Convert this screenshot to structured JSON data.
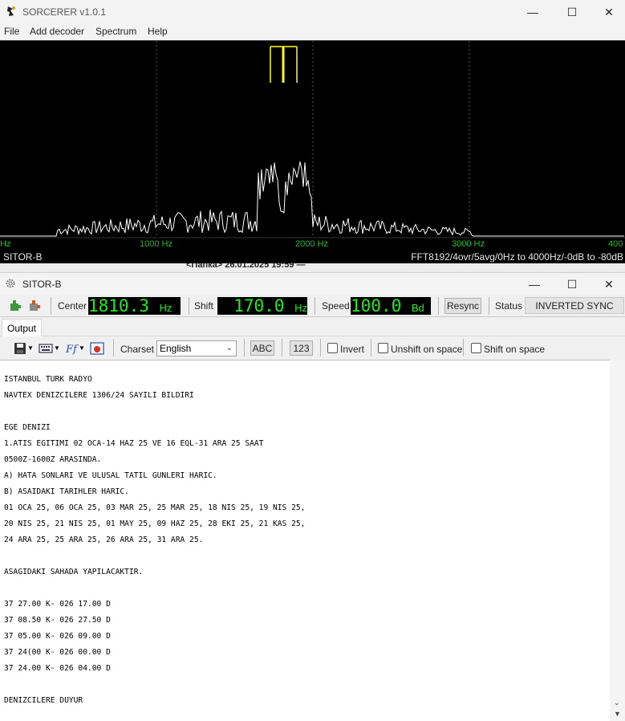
{
  "window": {
    "title": "SORCERER v1.0.1"
  },
  "menu": [
    "File",
    "Add decoder",
    "Spectrum",
    "Help"
  ],
  "spectrum": {
    "freq_labels": [
      "Hz",
      "1000 Hz",
      "2000 Hz",
      "3000 Hz",
      "400"
    ],
    "decoder_label": "SITOR-B",
    "fft_info": "FFT8192/4ovr/5avg/0Hz to 4000Hz/-0dB to -80dB",
    "waterfall_text": "<Папка> 26.01.2025 19:59 —",
    "colors": {
      "trace": "#ffffff",
      "marker": "#ffff00",
      "freq_text": "#18c418",
      "grid": "#555555"
    }
  },
  "decoder": {
    "title": "SITOR-B",
    "center_label": "Center",
    "center_value": "1810.3",
    "center_unit": "Hz",
    "shift_label": "Shift",
    "shift_value": "170.0",
    "shift_unit": "Hz",
    "speed_label": "Speed",
    "speed_value": "100.0",
    "speed_unit": "Bd",
    "resync_label": "Resync",
    "status_label": "Status",
    "status_value": "INVERTED SYNC"
  },
  "output": {
    "tab_label": "Output",
    "charset_label": "Charset",
    "charset_value": "English",
    "abc_label": "ABC",
    "num_label": "123",
    "invert_label": "Invert",
    "unshift_label": "Unshift on space",
    "shift_label": "Shift on space",
    "lines": [
      "ISTANBUL TURK RADYO",
      "NAVTEX DENIZCILERE 1306/24 SAYILI BILDIRI",
      "",
      "EGE DENIZI",
      "1.ATIS EGITIMI 02 OCA-14 HAZ 25 VE 16 EQL-31 ARA 25 SAAT",
      "0500Z-1600Z ARASINDA.",
      "A) HATA SONLARI VE ULUSAL TATIL GUNLERI HARIC.",
      "B) ASAIDAKI TARIHLER HARIC.",
      "01 OCA 25, 06 OCA 25, 03 MAR 25, 25 MAR 25, 18 NIS 25, 19 NIS 25,",
      "20 NIS 25, 21 NIS 25, 01 MAY 25, 09 HAZ 25, 28 EKI 25, 21 KAS 25,",
      "24 ARA 25, 25 ARA 25, 26 ARA 25, 31 ARA 25.",
      "",
      "ASAGIDAKI SAHADA YAPILACAKTIR.",
      "",
      "37 27.00 K- 026 17.00 D",
      "37 08.50 K- 026 27.50 D",
      "37 05.00 K- 026 09.00 D",
      "37 24(00 K- 026 00.00 D",
      "37 24.00 K- 026 04.00 D",
      "",
      "DENIZCILERE DUYUR"
    ]
  }
}
